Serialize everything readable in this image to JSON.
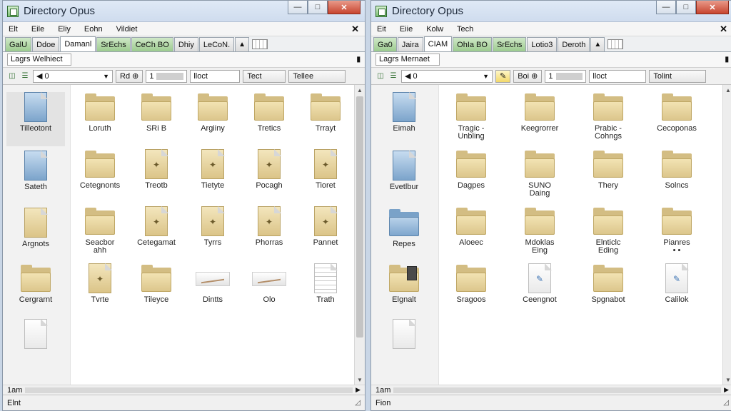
{
  "colors": {
    "titlebar": "#d7e3f3",
    "folder": "#dcc68c",
    "close": "#c7452f",
    "tab_green": "#9ccb8f"
  },
  "windows": [
    {
      "title": "Directory Opus",
      "controls": {
        "minimize": "—",
        "maximize": "□",
        "close": "✕"
      },
      "menu": [
        "Elt",
        "Eile",
        "Eliy",
        "Eohn",
        "Vildiet"
      ],
      "menu_close": "✕",
      "tabs": [
        "GalU",
        "Ddoe",
        "Damanl",
        "SrEchs",
        "CeCh BO",
        "Dhiy",
        "LeCoN."
      ],
      "tab_pin": "▲",
      "address": "Lagrs  Welhiect",
      "address_pin": "▮",
      "toolbar": {
        "nav": "◀ 0",
        "btn1": "Rd ⊕",
        "field1": "1",
        "btn2": "lloct",
        "btn3": "Tect",
        "btn4": "Tellee"
      },
      "sidebar": [
        {
          "label": "Tilleotont",
          "icon": "blue-page-icon"
        },
        {
          "label": "Sateth",
          "icon": "blue-page-icon"
        },
        {
          "label": "Argnots",
          "icon": "tan-page-icon"
        },
        {
          "label": "Cergrarnt",
          "icon": "folder-icon"
        },
        {
          "label": "",
          "icon": "blank-page-icon"
        }
      ],
      "files": [
        {
          "label": "Loruth",
          "icon": "folder-icon"
        },
        {
          "label": "SRi B",
          "icon": "folder-icon"
        },
        {
          "label": "Argiiny",
          "icon": "folder-icon"
        },
        {
          "label": "Tretics",
          "icon": "folder-icon"
        },
        {
          "label": "Trrayt",
          "icon": "folder-icon"
        },
        {
          "label": "Cetegnonts",
          "icon": "folder-icon"
        },
        {
          "label": "Treotb",
          "icon": "tan-page-icon"
        },
        {
          "label": "Tietyte",
          "icon": "tan-page-icon"
        },
        {
          "label": "Pocagh",
          "icon": "tan-page-icon"
        },
        {
          "label": "Tioret",
          "icon": "tan-page-icon"
        },
        {
          "label": "Seacbor\nahh",
          "icon": "folder-icon"
        },
        {
          "label": "Cetegamat",
          "icon": "tan-page-icon"
        },
        {
          "label": "Tyrrs",
          "icon": "tan-page-icon"
        },
        {
          "label": "Phorras",
          "icon": "tan-page-icon"
        },
        {
          "label": "Pannet",
          "icon": "tan-page-icon"
        },
        {
          "label": "Tvrte",
          "icon": "tan-page-icon"
        },
        {
          "label": "Tileyce",
          "icon": "folder-icon"
        },
        {
          "label": "Dintts",
          "icon": "flat-image-icon"
        },
        {
          "label": "Olo",
          "icon": "flat-image-icon"
        },
        {
          "label": "Trath",
          "icon": "lined-page-icon"
        }
      ],
      "status": {
        "text": "Elnt",
        "field": "1am",
        "grip": "◿"
      }
    },
    {
      "title": "Directory Opus",
      "controls": {
        "minimize": "—",
        "maximize": "□",
        "close": "✕"
      },
      "menu": [
        "Eit",
        "Eiie",
        "Kolw",
        "Tech"
      ],
      "menu_close": "✕",
      "tabs": [
        "Ga0",
        "Jaira",
        "CIAM",
        "OhIa BO",
        "SrEchs",
        "Lotio3",
        "Deroth"
      ],
      "tab_pin": "▲",
      "address": "Lagrs  Mernaet",
      "address_pin": "▮",
      "toolbar": {
        "nav": "◀ 0",
        "btn1": "Boi ⊕",
        "field1": "1",
        "btn2": "lloct",
        "btn3": "Tolint"
      },
      "sidebar": [
        {
          "label": "Eimah",
          "icon": "blue-page-icon"
        },
        {
          "label": "Evetlbur",
          "icon": "blue-page-icon"
        },
        {
          "label": "Repes",
          "icon": "blue-folder-icon"
        },
        {
          "label": "Elgnalt",
          "icon": "folder-icon"
        },
        {
          "label": "",
          "icon": "blank-page-icon"
        }
      ],
      "files": [
        {
          "label": "Tragic -\nUnbling",
          "icon": "folder-icon"
        },
        {
          "label": "Keegrorrer",
          "icon": "folder-icon"
        },
        {
          "label": "Prabic -\nCohngs",
          "icon": "folder-icon"
        },
        {
          "label": "Cecoponas",
          "icon": "folder-icon"
        },
        {
          "label": "Dagpes",
          "icon": "folder-icon"
        },
        {
          "label": "SUNO\nDaing",
          "icon": "folder-icon"
        },
        {
          "label": "Thery",
          "icon": "folder-icon"
        },
        {
          "label": "Solncs",
          "icon": "folder-icon"
        },
        {
          "label": "Aloeec",
          "icon": "folder-icon"
        },
        {
          "label": "Mdoklas\nEing",
          "icon": "folder-icon"
        },
        {
          "label": "Elnticlc\nEding",
          "icon": "folder-icon"
        },
        {
          "label": "Pianres\n• •",
          "icon": "folder-icon"
        },
        {
          "label": "Sragoos",
          "icon": "folder-icon"
        },
        {
          "label": "Ceengnot",
          "icon": "tool-page-icon"
        },
        {
          "label": "Spgnabot",
          "icon": "folder-icon"
        },
        {
          "label": "Calilok",
          "icon": "tool-page-icon"
        }
      ],
      "status": {
        "text": "Fion",
        "field": "1am",
        "grip": "◿"
      }
    }
  ]
}
